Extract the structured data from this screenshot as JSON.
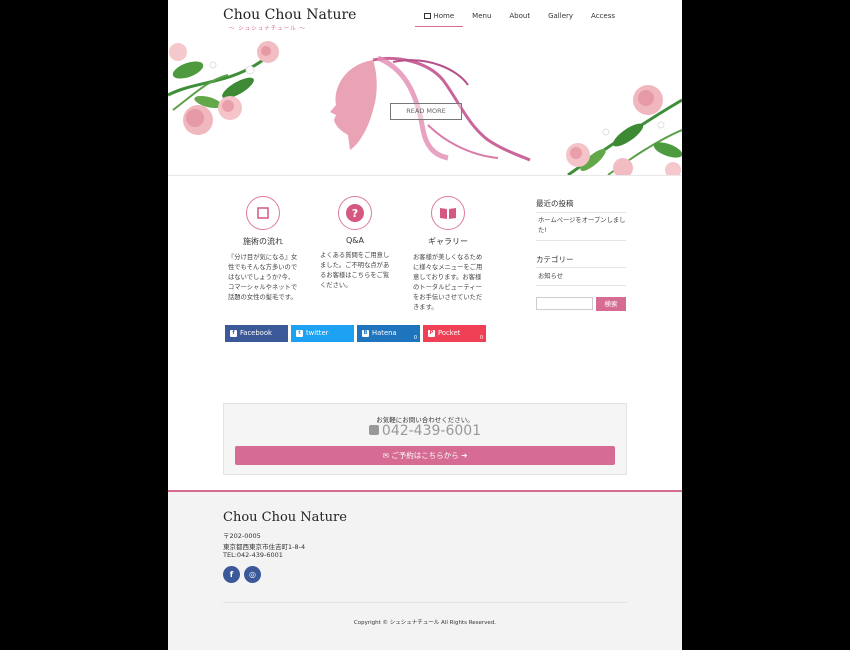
{
  "header": {
    "logo_title": "Chou Chou Nature",
    "logo_sub": "〜 シュシュナチュール 〜",
    "nav": [
      "Home",
      "Menu",
      "About",
      "Gallery",
      "Access"
    ]
  },
  "hero": {
    "read_more": "READ MORE"
  },
  "features": [
    {
      "icon": "square-icon",
      "title": "施術の流れ",
      "text": "『分け目が気になる』女性でもそんな方多いのではないでしょうか?今、コマーシャルやネットで話題の女性の髪毛です。"
    },
    {
      "icon": "question-icon",
      "title": "Q&A",
      "text": "よくある質問をご用意しました。ご不明な点があるお客様はこちらをご覧ください。"
    },
    {
      "icon": "book-icon",
      "title": "ギャラリー",
      "text": "お客様が美しくなるために様々なメニューをご用意しております。お客様のトータルビューティーをお手伝いさせていただきます。"
    }
  ],
  "share": [
    {
      "label": "Facebook",
      "count": "",
      "color": "#3b5998"
    },
    {
      "label": "twitter",
      "count": "",
      "color": "#1da1f2"
    },
    {
      "label": "Hatena",
      "count": "0",
      "color": "#1f75bd"
    },
    {
      "label": "Pocket",
      "count": "0",
      "color": "#ef4056"
    }
  ],
  "sidebar": {
    "recent_heading": "最近の投稿",
    "recent_post": "ホームページをオープンしました!",
    "category_heading": "カテゴリー",
    "category_item": "お知らせ",
    "search_button": "検索"
  },
  "contact": {
    "message": "お気軽にお問い合わせください。",
    "tel": "042-439-6001",
    "button": "ご予約はこちらから"
  },
  "footer": {
    "title": "Chou Chou Nature",
    "postal": "〒202-0005",
    "address": "東京都西東京市住吉町1-8-4",
    "tel": "TEL:042-439-6001",
    "copyright": "Copyright © シュシュナチュール All Rights Reserved."
  },
  "colors": {
    "accent": "#d66b93",
    "footer_bg": "#f3f3f3"
  }
}
